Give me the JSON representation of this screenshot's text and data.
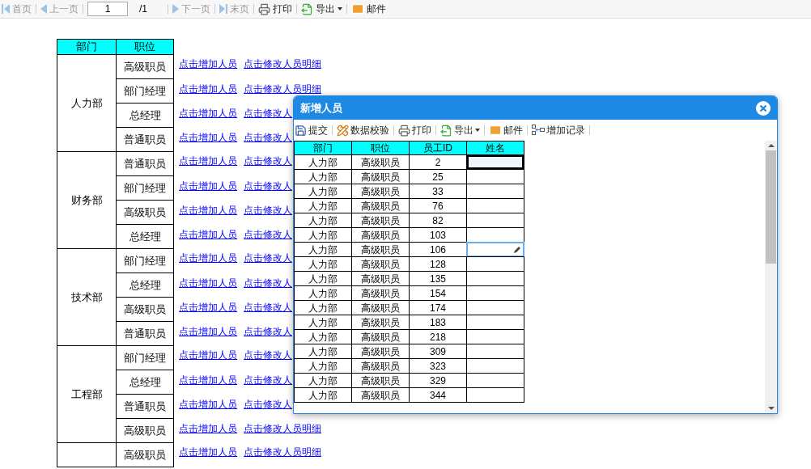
{
  "toolbar": {
    "items": [
      {
        "kind": "first",
        "label": "首页",
        "disabled": true
      },
      {
        "kind": "prev",
        "label": "上一页",
        "disabled": true
      },
      {
        "kind": "page",
        "value": "1",
        "total": "/1"
      },
      {
        "kind": "next",
        "label": "下一页",
        "disabled": true
      },
      {
        "kind": "last",
        "label": "末页",
        "disabled": true
      },
      {
        "kind": "print",
        "label": "打印",
        "disabled": false
      },
      {
        "kind": "export",
        "label": "导出",
        "disabled": false
      },
      {
        "kind": "mail",
        "label": "邮件",
        "disabled": false
      }
    ]
  },
  "report": {
    "columns": [
      "部门",
      "职位"
    ],
    "groups": [
      {
        "dept": "人力部",
        "rows": [
          {
            "position": "高级职员",
            "links": [
              "点击增加人员",
              "点击修改人员明细"
            ]
          },
          {
            "position": "部门经理",
            "links": [
              "点击增加人员",
              "点击修改人员明细"
            ]
          },
          {
            "position": "总经理",
            "links": [
              "点击增加人员",
              "点击修改人"
            ]
          },
          {
            "position": "普通职员",
            "links": [
              "点击增加人员",
              "点击修改人"
            ]
          }
        ]
      },
      {
        "dept": "财务部",
        "rows": [
          {
            "position": "普通职员",
            "links": [
              "点击增加人员",
              "点击修改人"
            ]
          },
          {
            "position": "部门经理",
            "links": [
              "点击增加人员",
              "点击修改人"
            ]
          },
          {
            "position": "高级职员",
            "links": [
              "点击增加人员",
              "点击修改人"
            ]
          },
          {
            "position": "总经理",
            "links": [
              "点击增加人员",
              "点击修改人"
            ]
          }
        ]
      },
      {
        "dept": "技术部",
        "rows": [
          {
            "position": "部门经理",
            "links": [
              "点击增加人员",
              "点击修改人"
            ]
          },
          {
            "position": "总经理",
            "links": [
              "点击增加人员",
              "点击修改人"
            ]
          },
          {
            "position": "高级职员",
            "links": [
              "点击增加人员",
              "点击修改人"
            ]
          },
          {
            "position": "普通职员",
            "links": [
              "点击增加人员",
              "点击修改人"
            ]
          }
        ]
      },
      {
        "dept": "工程部",
        "rows": [
          {
            "position": "部门经理",
            "links": [
              "点击增加人员",
              "点击修改人"
            ]
          },
          {
            "position": "总经理",
            "links": [
              "点击增加人员",
              "点击修改人"
            ]
          },
          {
            "position": "普通职员",
            "links": [
              "点击增加人员",
              "点击修改人"
            ]
          },
          {
            "position": "高级职员",
            "links": [
              "点击增加人员",
              "点击修改人员明细"
            ]
          }
        ]
      },
      {
        "rows": [
          {
            "position": "高级职员",
            "links": [
              "点击增加人员",
              "点击修改人员明细"
            ]
          }
        ]
      }
    ]
  },
  "dialog": {
    "title": "新增人员",
    "toolbar": [
      {
        "kind": "submit",
        "label": "提交"
      },
      {
        "kind": "check",
        "label": "数据校验"
      },
      {
        "kind": "print",
        "label": "打印"
      },
      {
        "kind": "export",
        "label": "导出"
      },
      {
        "kind": "mail",
        "label": "邮件"
      },
      {
        "kind": "add",
        "label": "增加记录"
      }
    ],
    "columns": [
      "部门",
      "职位",
      "员工ID",
      "姓名"
    ],
    "rows": [
      {
        "dept": "人力部",
        "position": "高级职员",
        "id": "2",
        "selected": true,
        "editing": false
      },
      {
        "dept": "人力部",
        "position": "高级职员",
        "id": "25",
        "selected": false,
        "editing": false
      },
      {
        "dept": "人力部",
        "position": "高级职员",
        "id": "33",
        "selected": false,
        "editing": false
      },
      {
        "dept": "人力部",
        "position": "高级职员",
        "id": "76",
        "selected": false,
        "editing": false
      },
      {
        "dept": "人力部",
        "position": "高级职员",
        "id": "82",
        "selected": false,
        "editing": false
      },
      {
        "dept": "人力部",
        "position": "高级职员",
        "id": "103",
        "selected": false,
        "editing": false
      },
      {
        "dept": "人力部",
        "position": "高级职员",
        "id": "106",
        "selected": false,
        "editing": true
      },
      {
        "dept": "人力部",
        "position": "高级职员",
        "id": "128",
        "selected": false,
        "editing": false
      },
      {
        "dept": "人力部",
        "position": "高级职员",
        "id": "135",
        "selected": false,
        "editing": false
      },
      {
        "dept": "人力部",
        "position": "高级职员",
        "id": "154",
        "selected": false,
        "editing": false
      },
      {
        "dept": "人力部",
        "position": "高级职员",
        "id": "174",
        "selected": false,
        "editing": false
      },
      {
        "dept": "人力部",
        "position": "高级职员",
        "id": "183",
        "selected": false,
        "editing": false
      },
      {
        "dept": "人力部",
        "position": "高级职员",
        "id": "218",
        "selected": false,
        "editing": false
      },
      {
        "dept": "人力部",
        "position": "高级职员",
        "id": "309",
        "selected": false,
        "editing": false
      },
      {
        "dept": "人力部",
        "position": "高级职员",
        "id": "323",
        "selected": false,
        "editing": false
      },
      {
        "dept": "人力部",
        "position": "高级职员",
        "id": "329",
        "selected": false,
        "editing": false
      },
      {
        "dept": "人力部",
        "position": "高级职员",
        "id": "344",
        "selected": false,
        "editing": false
      }
    ]
  }
}
